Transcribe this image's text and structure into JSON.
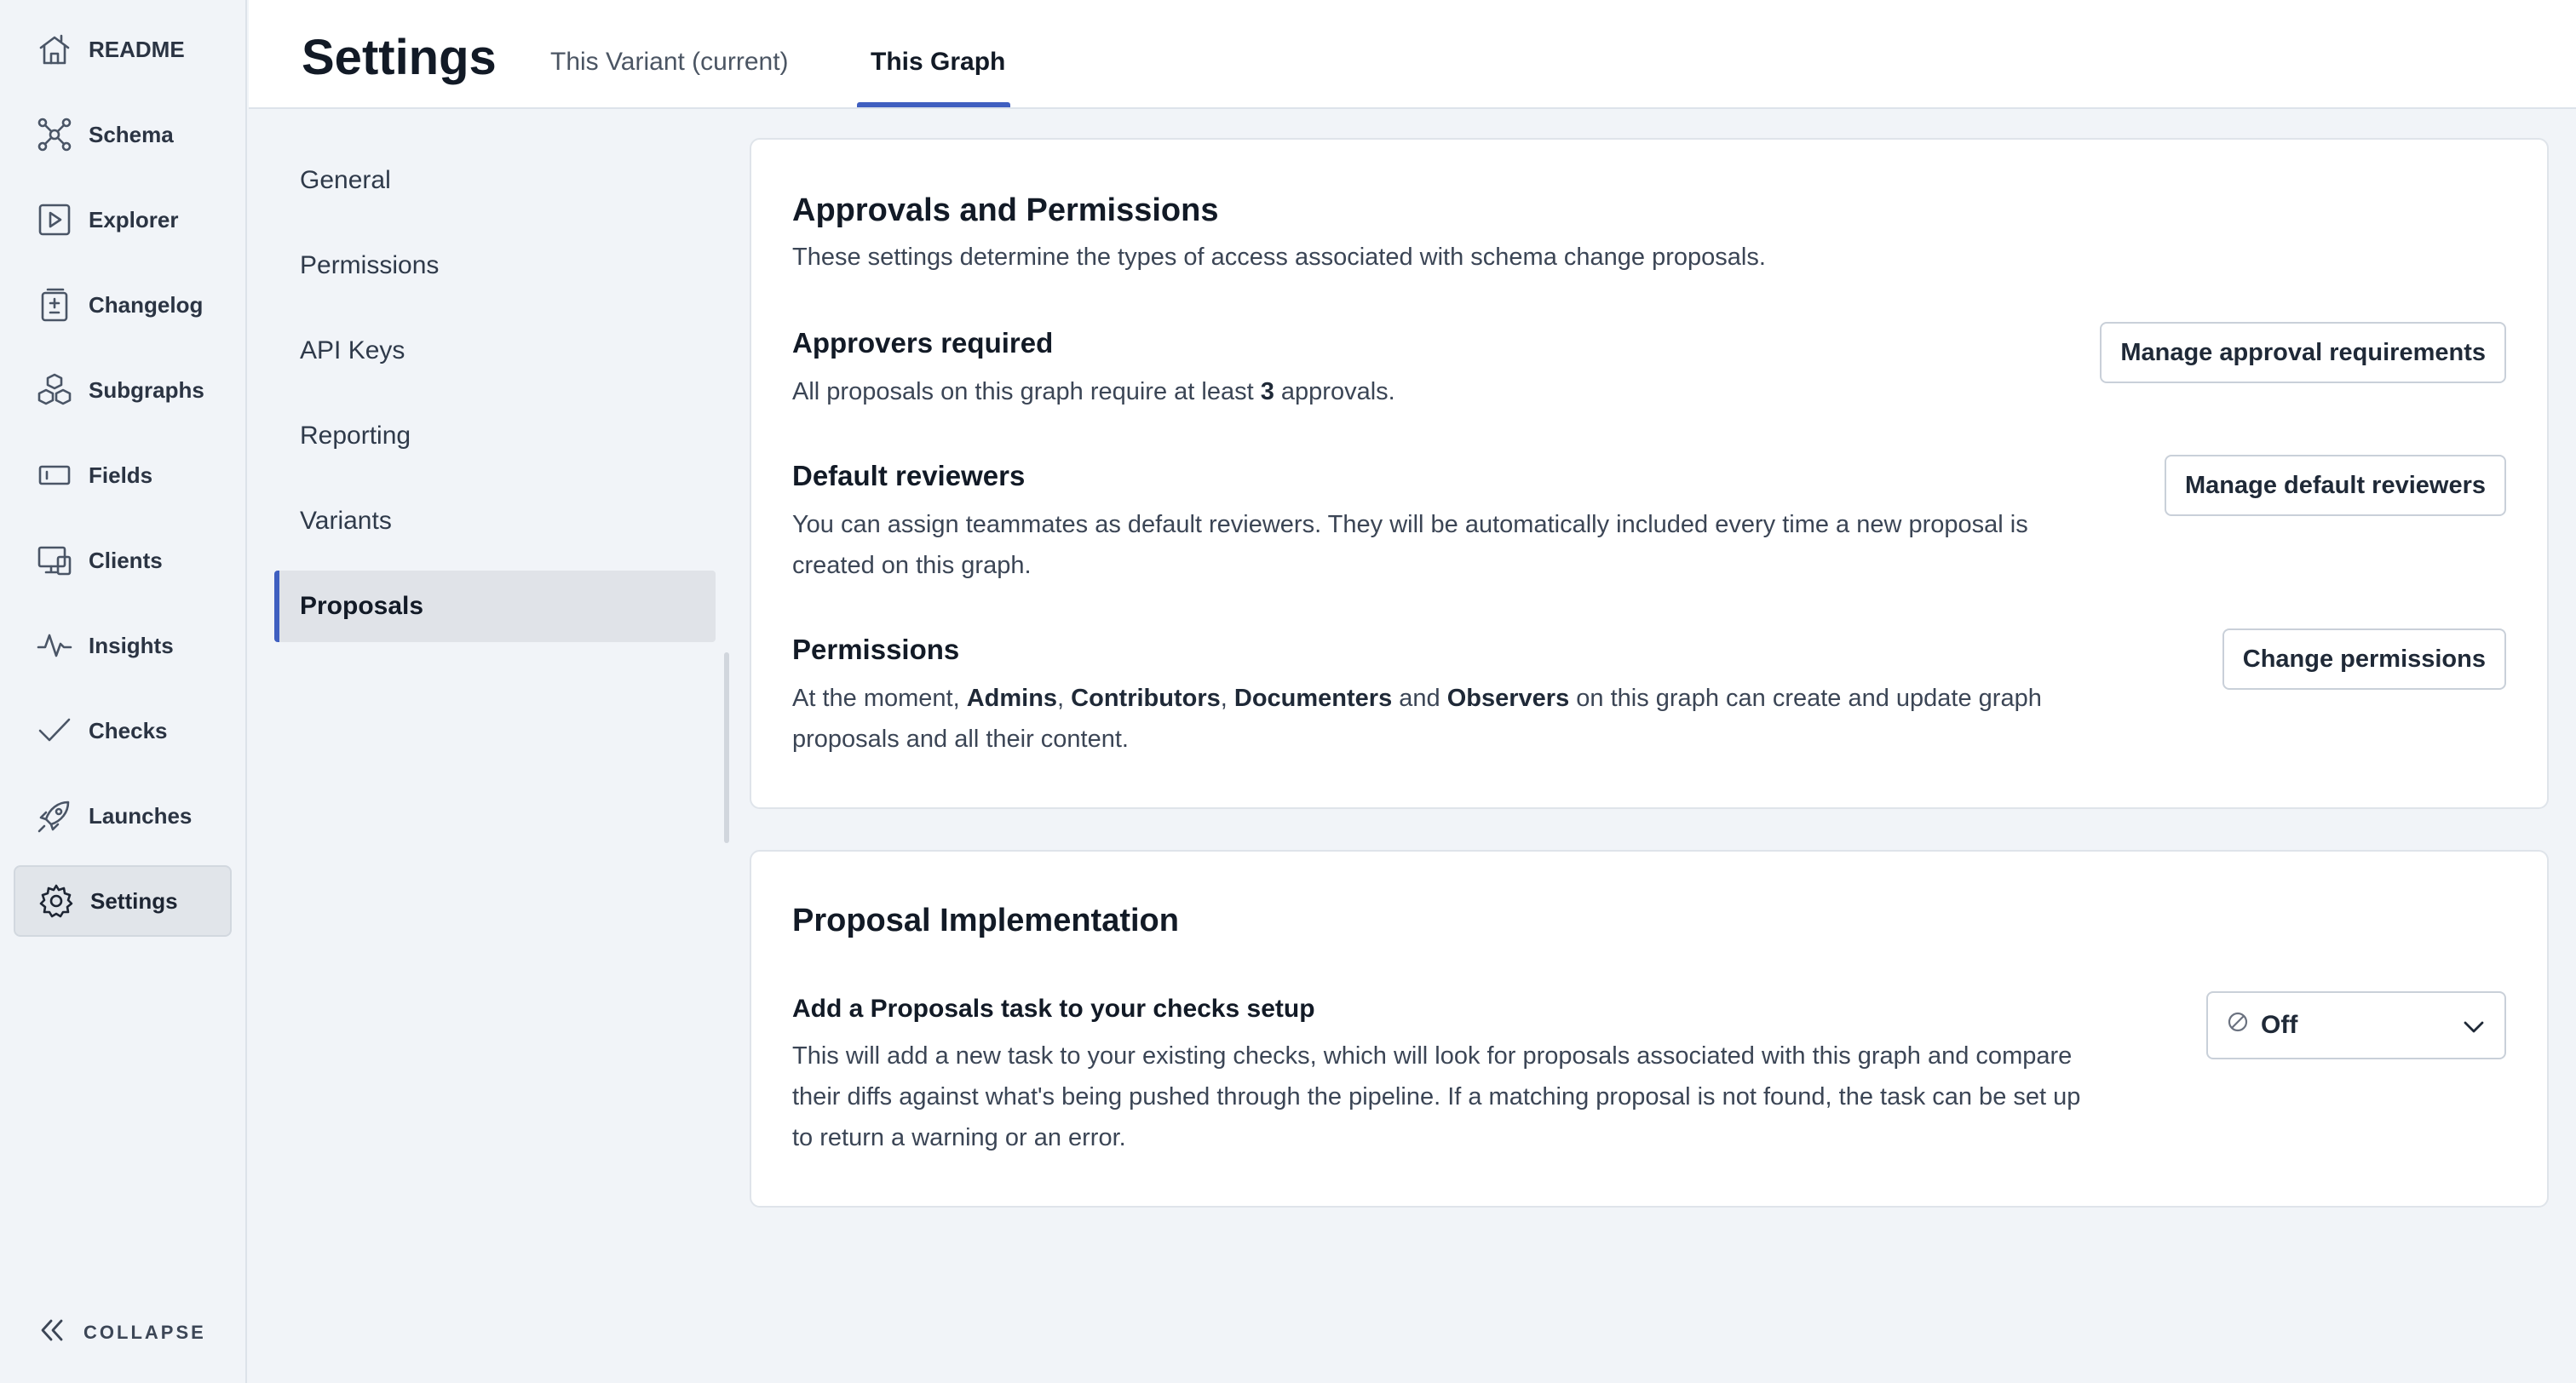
{
  "nav": {
    "items": [
      {
        "label": "README",
        "icon": "readme-house-icon"
      },
      {
        "label": "Schema",
        "icon": "schema-graph-icon"
      },
      {
        "label": "Explorer",
        "icon": "explorer-play-icon"
      },
      {
        "label": "Changelog",
        "icon": "changelog-diff-icon"
      },
      {
        "label": "Subgraphs",
        "icon": "subgraphs-cubes-icon"
      },
      {
        "label": "Fields",
        "icon": "fields-icon"
      },
      {
        "label": "Clients",
        "icon": "clients-devices-icon"
      },
      {
        "label": "Insights",
        "icon": "insights-pulse-icon"
      },
      {
        "label": "Checks",
        "icon": "checks-checkmark-icon"
      },
      {
        "label": "Launches",
        "icon": "launches-rocket-icon"
      },
      {
        "label": "Settings",
        "icon": "settings-gear-icon",
        "active": true
      }
    ],
    "collapse_label": "COLLAPSE"
  },
  "header": {
    "title": "Settings",
    "tabs": [
      {
        "label": "This Variant (current)",
        "active": false
      },
      {
        "label": "This Graph",
        "active": true
      }
    ]
  },
  "subnav": {
    "items": [
      {
        "label": "General"
      },
      {
        "label": "Permissions"
      },
      {
        "label": "API Keys"
      },
      {
        "label": "Reporting"
      },
      {
        "label": "Variants"
      },
      {
        "label": "Proposals",
        "active": true
      }
    ]
  },
  "approvals_card": {
    "title": "Approvals and Permissions",
    "subtitle": "These settings determine the types of access associated with schema change proposals.",
    "approvers": {
      "title": "Approvers required",
      "desc_prefix": "All proposals on this graph require at least ",
      "count": "3",
      "desc_suffix": " approvals.",
      "button": "Manage approval requirements"
    },
    "reviewers": {
      "title": "Default reviewers",
      "desc": "You can assign teammates as default reviewers. They will be automatically included every time a new proposal is created on this graph.",
      "button": "Manage default reviewers"
    },
    "permissions": {
      "title": "Permissions",
      "desc_prefix": "At the moment, ",
      "role_admins": "Admins",
      "sep1": ", ",
      "role_contributors": "Contributors",
      "sep2": ", ",
      "role_documenters": "Documenters",
      "sep3": " and ",
      "role_observers": "Observers",
      "desc_suffix": " on this graph can create and update graph proposals and all their content.",
      "button": "Change permissions"
    }
  },
  "implementation_card": {
    "title": "Proposal Implementation",
    "task_title": "Add a Proposals task to your checks setup",
    "task_desc": "This will add a new task to your existing checks, which will look for proposals associated with this graph and compare their diffs against what's being pushed through the pipeline. If a matching proposal is not found, the task can be set up to return a warning or an error.",
    "select_value": "Off",
    "select_icon": "ban-icon"
  },
  "colors": {
    "accent": "#3f5fc0",
    "nav_bg": "#f1f4f8",
    "card_bg": "#ffffff"
  }
}
